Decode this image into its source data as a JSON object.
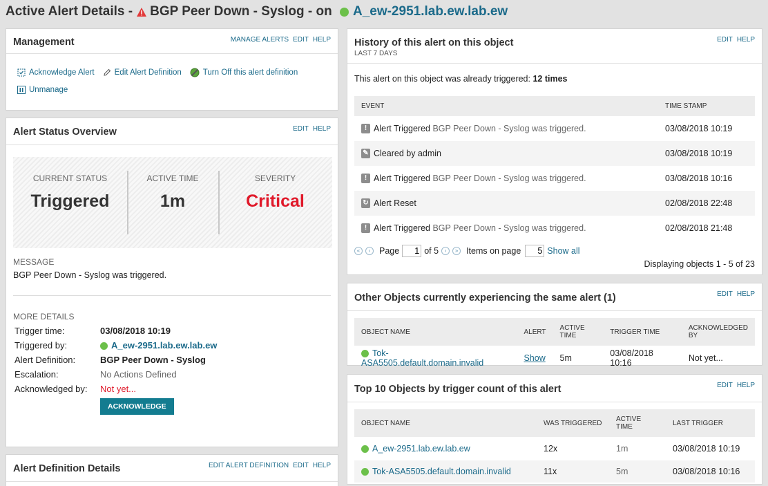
{
  "page": {
    "prefix": "Active Alert Details - ",
    "alert_name": "BGP Peer Down - Syslog",
    "on": " - on ",
    "node": "A_ew-2951.lab.ew.lab.ew"
  },
  "management": {
    "title": "Management",
    "actions": [
      "MANAGE ALERTS",
      "EDIT",
      "HELP"
    ],
    "links": {
      "ack": "Acknowledge Alert",
      "edit_def": "Edit Alert Definition",
      "turn_off": "Turn Off this alert definition",
      "unmanage": "Unmanage"
    }
  },
  "status": {
    "title": "Alert Status Overview",
    "actions": [
      "EDIT",
      "HELP"
    ],
    "current_label": "CURRENT STATUS",
    "current_value": "Triggered",
    "active_label": "ACTIVE TIME",
    "active_value": "1m",
    "severity_label": "SEVERITY",
    "severity_value": "Critical",
    "message_label": "MESSAGE",
    "message": "BGP Peer Down - Syslog was triggered.",
    "more_label": "MORE DETAILS",
    "trigger_time_k": "Trigger time:",
    "trigger_time_v": "03/08/2018 10:19",
    "triggered_by_k": "Triggered by:",
    "triggered_by_v": "A_ew-2951.lab.ew.lab.ew",
    "definition_k": "Alert Definition:",
    "definition_v": "BGP Peer Down - Syslog",
    "escalation_k": "Escalation:",
    "escalation_v": "No Actions Defined",
    "acked_k": "Acknowledged by:",
    "acked_v": "Not yet...",
    "ack_button": "ACKNOWLEDGE"
  },
  "definition_details": {
    "title": "Alert Definition Details",
    "actions": [
      "EDIT ALERT DEFINITION",
      "EDIT",
      "HELP"
    ]
  },
  "history": {
    "title": "History of this alert on this object",
    "subtitle": "LAST 7 DAYS",
    "actions": [
      "EDIT",
      "HELP"
    ],
    "summary_prefix": "This alert on this object was already triggered: ",
    "summary_count": "12 times",
    "col_event": "EVENT",
    "col_time": "TIME STAMP",
    "rows": [
      {
        "event": "Alert Triggered",
        "detail": "BGP Peer Down - Syslog was triggered.",
        "time": "03/08/2018 10:19"
      },
      {
        "event": "Cleared by admin",
        "detail": "",
        "time": "03/08/2018 10:19"
      },
      {
        "event": "Alert Triggered",
        "detail": "BGP Peer Down - Syslog was triggered.",
        "time": "03/08/2018 10:16"
      },
      {
        "event": "Alert Reset",
        "detail": "",
        "time": "02/08/2018 22:48"
      },
      {
        "event": "Alert Triggered",
        "detail": "BGP Peer Down - Syslog was triggered.",
        "time": "02/08/2018 21:48"
      }
    ],
    "pager": {
      "page_label": "Page",
      "page": "1",
      "of": "of 5",
      "items_label": "Items on page",
      "items": "5",
      "show_all": "Show all"
    },
    "displaying": "Displaying objects 1 - 5 of 23"
  },
  "others": {
    "title": "Other Objects currently experiencing the same alert (1)",
    "actions": [
      "EDIT",
      "HELP"
    ],
    "cols": [
      "OBJECT NAME",
      "ALERT",
      "ACTIVE TIME",
      "TRIGGER TIME",
      "ACKNOWLEDGED BY"
    ],
    "row": {
      "name": "Tok-ASA5505.default.domain.invalid",
      "alert": "Show",
      "active": "5m",
      "trigger": "03/08/2018 10:16",
      "acked": "Not yet..."
    }
  },
  "top10": {
    "title": "Top 10 Objects by trigger count of this alert",
    "actions": [
      "EDIT",
      "HELP"
    ],
    "cols": [
      "OBJECT NAME",
      "WAS TRIGGERED",
      "ACTIVE TIME",
      "LAST TRIGGER"
    ],
    "rows": [
      {
        "name": "A_ew-2951.lab.ew.lab.ew",
        "count": "12x",
        "active": "1m",
        "last": "03/08/2018 10:19"
      },
      {
        "name": "Tok-ASA5505.default.domain.invalid",
        "count": "11x",
        "active": "5m",
        "last": "03/08/2018 10:16"
      }
    ]
  }
}
